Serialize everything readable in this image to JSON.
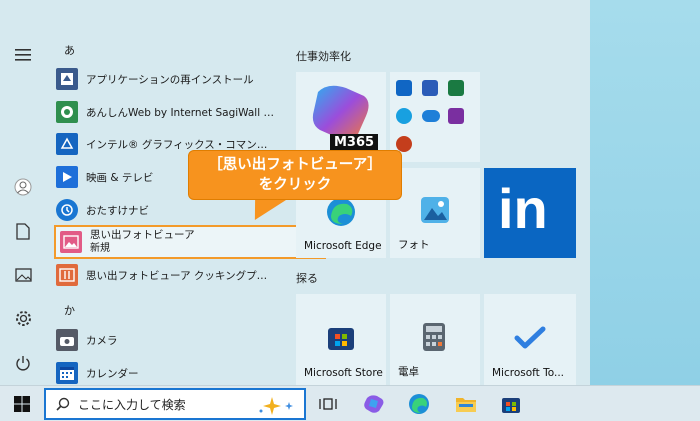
{
  "start_menu": {
    "sections": [
      {
        "letter": "あ",
        "items": [
          {
            "label": "アプリケーションの再インストール",
            "icon": "reinstall-app-icon"
          },
          {
            "label": "あんしんWeb by Internet SagiWall for d...",
            "icon": "sagiwall-icon"
          },
          {
            "label": "インテル® グラフィックス・コマンド・センター",
            "icon": "intel-graphics-icon"
          },
          {
            "label": "映画 & テレビ",
            "icon": "movies-tv-icon"
          },
          {
            "label": "おたすけナビ",
            "icon": "otasuke-navi-icon"
          },
          {
            "label": "思い出フォトビューア",
            "sublabel": "新規",
            "icon": "photo-viewer-icon"
          },
          {
            "label": "思い出フォトビューア クッキングプラス",
            "icon": "cooking-plus-icon"
          }
        ]
      },
      {
        "letter": "か",
        "items": [
          {
            "label": "カメラ",
            "icon": "camera-icon"
          },
          {
            "label": "カレンダー",
            "icon": "calendar-icon"
          }
        ]
      }
    ],
    "groups": [
      {
        "title": "仕事効率化"
      },
      {
        "title": "探る"
      }
    ],
    "tiles": {
      "m365": "M365",
      "edge": "Microsoft Edge",
      "photos": "フォト",
      "store": "Microsoft Store",
      "calculator": "電卓",
      "todo": "Microsoft To...",
      "linkedin": "in"
    }
  },
  "callout": {
    "line1": "［思い出フォトビューア］",
    "line2": "をクリック"
  },
  "taskbar": {
    "search_placeholder": "ここに入力して検索"
  },
  "colors": {
    "accent": "#f7931e",
    "selection_border": "#f39a2a",
    "linkedin": "#0a66c2",
    "search_border": "#1a76d2"
  }
}
